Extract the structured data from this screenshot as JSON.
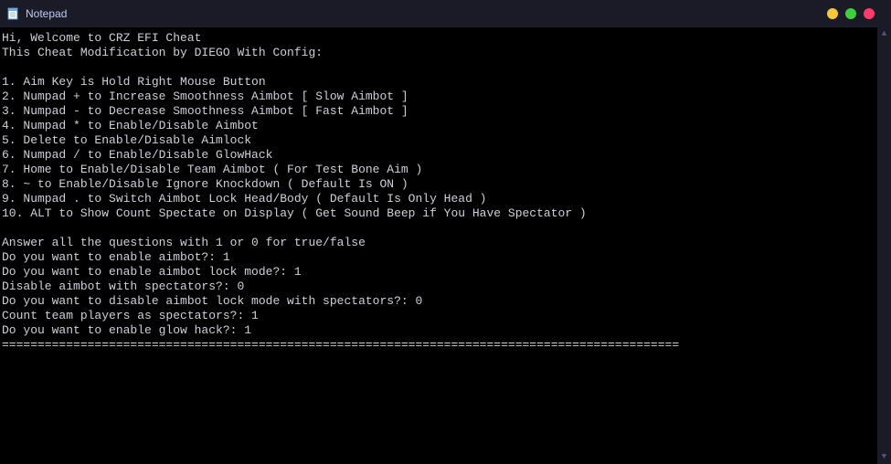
{
  "window": {
    "title": "Notepad",
    "controls": {
      "minimize_color": "#f7c63b",
      "maximize_color": "#3ecf3e",
      "close_color": "#ff3b6b"
    }
  },
  "body": {
    "welcome": "Hi, Welcome to CRZ EFI Cheat",
    "modline": "This Cheat Modification by DIEGO With Config:",
    "instructions": [
      "1. Aim Key is Hold Right Mouse Button",
      "2. Numpad + to Increase Smoothness Aimbot [ Slow Aimbot ]",
      "3. Numpad - to Decrease Smoothness Aimbot [ Fast Aimbot ]",
      "4. Numpad * to Enable/Disable Aimbot",
      "5. Delete to Enable/Disable Aimlock",
      "6. Numpad / to Enable/Disable GlowHack",
      "7. Home to Enable/Disable Team Aimbot ( For Test Bone Aim )",
      "8. ~ to Enable/Disable Ignore Knockdown ( Default Is ON )",
      "9. Numpad . to Switch Aimbot Lock Head/Body ( Default Is Only Head )",
      "10. ALT to Show Count Spectate on Display ( Get Sound Beep if You Have Spectator )"
    ],
    "prompt_header": "Answer all the questions with 1 or 0 for true/false",
    "qa": [
      {
        "q": "Do you want to enable aimbot?:",
        "a": "1"
      },
      {
        "q": "Do you want to enable aimbot lock mode?:",
        "a": "1"
      },
      {
        "q": "Disable aimbot with spectators?:",
        "a": "0"
      },
      {
        "q": "Do you want to disable aimbot lock mode with spectators?:",
        "a": "0"
      },
      {
        "q": "Count team players as spectators?:",
        "a": "1"
      },
      {
        "q": "Do you want to enable glow hack?:",
        "a": "1"
      }
    ],
    "separator": "==============================================================================================="
  }
}
